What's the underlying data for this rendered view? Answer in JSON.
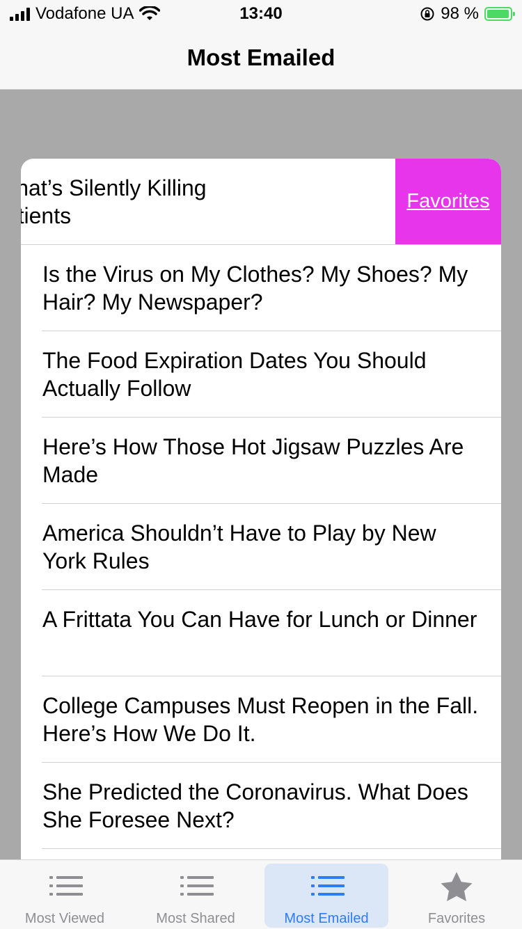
{
  "status_bar": {
    "carrier": "Vodafone UA",
    "time": "13:40",
    "battery": "98 %",
    "battery_level": 0.98,
    "battery_color": "#4cd964"
  },
  "nav": {
    "title": "Most Emailed"
  },
  "swiped_row": {
    "text_line1": "ection That’s Silently Killing",
    "text_line2": "virus Patients",
    "action_label": "Favorites",
    "action_color": "#e635ea"
  },
  "articles": [
    {
      "title": "Is the Virus on My Clothes? My Shoes? My Hair? My Newspaper?"
    },
    {
      "title": "The Food Expiration Dates You Should Actually Follow"
    },
    {
      "title": "Here’s How Those Hot Jigsaw Puzzles Are Made"
    },
    {
      "title": "America Shouldn’t Have to Play by New York Rules"
    },
    {
      "title": "A Frittata You Can Have for Lunch or Dinner"
    },
    {
      "title": "College Campuses Must Reopen in the Fall. Here’s How We Do It."
    },
    {
      "title": "She Predicted the Coronavirus. What Does She Foresee Next?"
    }
  ],
  "tabs": [
    {
      "label": "Most Viewed",
      "icon": "list-icon"
    },
    {
      "label": "Most Shared",
      "icon": "list-icon"
    },
    {
      "label": "Most Emailed",
      "icon": "list-icon",
      "active": true
    },
    {
      "label": "Favorites",
      "icon": "star-icon"
    }
  ],
  "colors": {
    "accent": "#2f7cf6",
    "inactive": "#8e8e93",
    "backdrop": "#a9a9a9"
  }
}
